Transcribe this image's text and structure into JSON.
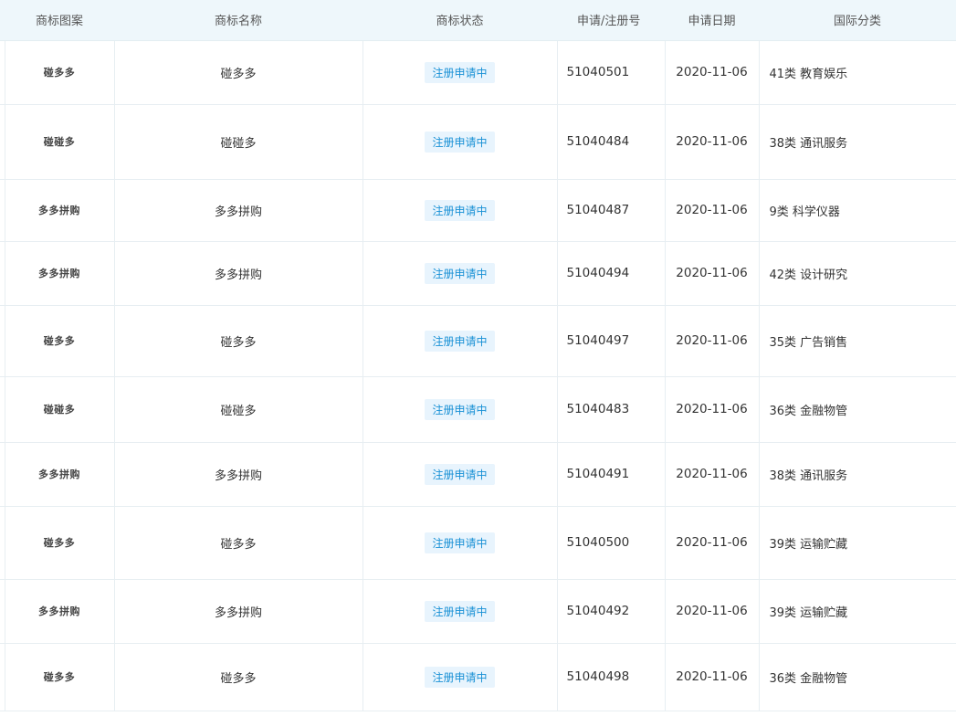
{
  "headers": [
    "商标图案",
    "商标名称",
    "商标状态",
    "申请/注册号",
    "申请日期",
    "国际分类"
  ],
  "rows": [
    {
      "logo": "碰多多",
      "name": "碰多多",
      "status": "注册申请中",
      "reg_no": "51040501",
      "date": "2020-11-06",
      "class": "41类 教育娱乐"
    },
    {
      "logo": "碰碰多",
      "name": "碰碰多",
      "status": "注册申请中",
      "reg_no": "51040484",
      "date": "2020-11-06",
      "class": "38类 通讯服务"
    },
    {
      "logo": "多多拼购",
      "name": "多多拼购",
      "status": "注册申请中",
      "reg_no": "51040487",
      "date": "2020-11-06",
      "class": "9类 科学仪器"
    },
    {
      "logo": "多多拼购",
      "name": "多多拼购",
      "status": "注册申请中",
      "reg_no": "51040494",
      "date": "2020-11-06",
      "class": "42类 设计研究"
    },
    {
      "logo": "碰多多",
      "name": "碰多多",
      "status": "注册申请中",
      "reg_no": "51040497",
      "date": "2020-11-06",
      "class": "35类 广告销售"
    },
    {
      "logo": "碰碰多",
      "name": "碰碰多",
      "status": "注册申请中",
      "reg_no": "51040483",
      "date": "2020-11-06",
      "class": "36类 金融物管"
    },
    {
      "logo": "多多拼购",
      "name": "多多拼购",
      "status": "注册申请中",
      "reg_no": "51040491",
      "date": "2020-11-06",
      "class": "38类 通讯服务"
    },
    {
      "logo": "碰多多",
      "name": "碰多多",
      "status": "注册申请中",
      "reg_no": "51040500",
      "date": "2020-11-06",
      "class": "39类 运输贮藏"
    },
    {
      "logo": "多多拼购",
      "name": "多多拼购",
      "status": "注册申请中",
      "reg_no": "51040492",
      "date": "2020-11-06",
      "class": "39类 运输贮藏"
    },
    {
      "logo": "碰多多",
      "name": "碰多多",
      "status": "注册申请中",
      "reg_no": "51040498",
      "date": "2020-11-06",
      "class": "36类 金融物管"
    }
  ]
}
